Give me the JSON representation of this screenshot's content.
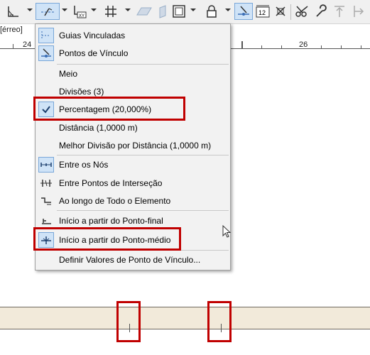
{
  "toolbar": {
    "buttons": [
      {
        "name": "ruler-angle-icon"
      },
      {
        "name": "guide-lines-icon"
      },
      {
        "name": "xy-coordinates-icon"
      },
      {
        "name": "grid-snap-icon"
      },
      {
        "name": "plane-icon"
      },
      {
        "name": "vertical-plane-icon"
      },
      {
        "name": "window-frame-icon"
      },
      {
        "name": "lock-icon"
      },
      {
        "name": "snap-points-icon"
      },
      {
        "name": "number-12-icon"
      },
      {
        "name": "intersection-icon"
      },
      {
        "name": "scissors-icon"
      },
      {
        "name": "wrench-icon"
      },
      {
        "name": "elevation-icon"
      },
      {
        "name": "align-icon"
      }
    ]
  },
  "view": {
    "story_tab": "[érreo]",
    "ruler_left": "24",
    "ruler_right": "26"
  },
  "menu": {
    "items": [
      {
        "label": "Guias Vinculadas",
        "icon": "guide-lines-icon",
        "selected": false
      },
      {
        "label": "Pontos de Vínculo",
        "icon": "snap-points-icon",
        "selected": true
      },
      {
        "label": "Meio",
        "icon": "",
        "selected": false
      },
      {
        "label": "Divisões (3)",
        "icon": "",
        "selected": false
      },
      {
        "label": "Percentagem (20,000%)",
        "icon": "checkmark-icon",
        "selected": true
      },
      {
        "label": "Distância (1,0000 m)",
        "icon": "",
        "selected": false
      },
      {
        "label": "Melhor Divisão por Distância (1,0000 m)",
        "icon": "",
        "selected": false
      },
      {
        "label": "Entre os Nós",
        "icon": "between-nodes-icon",
        "selected": true
      },
      {
        "label": "Entre Pontos de Interseção",
        "icon": "intersection-points-icon",
        "selected": false
      },
      {
        "label": "Ao longo de Todo o Elemento",
        "icon": "along-element-icon",
        "selected": false
      },
      {
        "label": "Início a partir do Ponto-final",
        "icon": "start-endpoint-icon",
        "selected": false
      },
      {
        "label": "Início a partir do Ponto-médio",
        "icon": "start-midpoint-icon",
        "selected": true
      },
      {
        "label": "Definir Valores de Ponto de Vínculo...",
        "icon": "",
        "selected": false
      }
    ]
  }
}
